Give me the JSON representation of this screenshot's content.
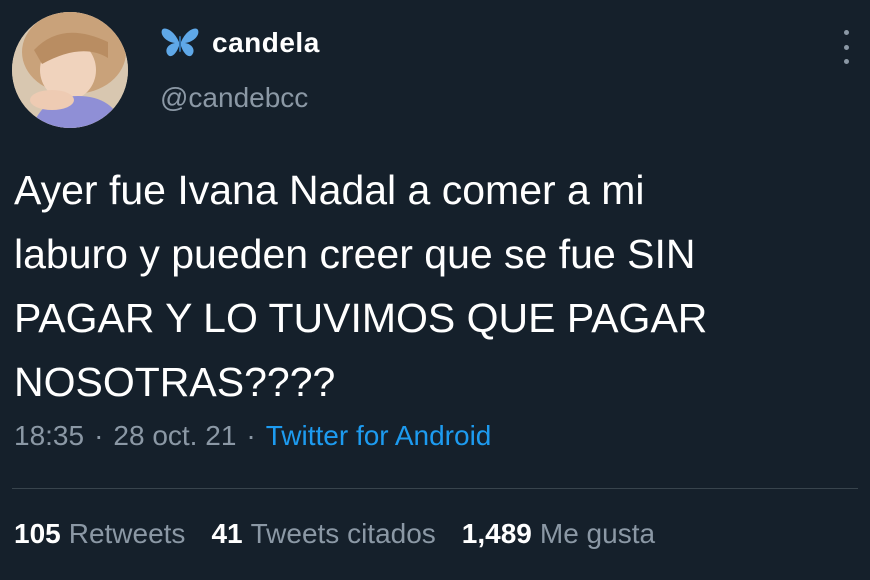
{
  "tweet": {
    "display_name": "candela",
    "handle": "@candebcc",
    "text": "Ayer fue Ivana Nadal a comer a mi\nlaburo y pueden creer que se fue SIN\nPAGAR Y LO TUVIMOS QUE PAGAR\nNOSOTRAS????",
    "time": "18:35",
    "date": "28 oct. 21",
    "separator": "·",
    "source": "Twitter for Android",
    "icons": {
      "name_emoji": "butterfly-icon",
      "more": "more-vertical-icon"
    }
  },
  "stats": {
    "retweets_count": "105",
    "retweets_label": "Retweets",
    "quotes_count": "41",
    "quotes_label": "Tweets citados",
    "likes_count": "1,489",
    "likes_label": "Me gusta"
  },
  "colors": {
    "background": "#15202b",
    "text": "#ffffff",
    "secondary": "#8b98a5",
    "link": "#1d9bf0",
    "divider": "#38444d",
    "butterfly": "#5fa8e8"
  }
}
